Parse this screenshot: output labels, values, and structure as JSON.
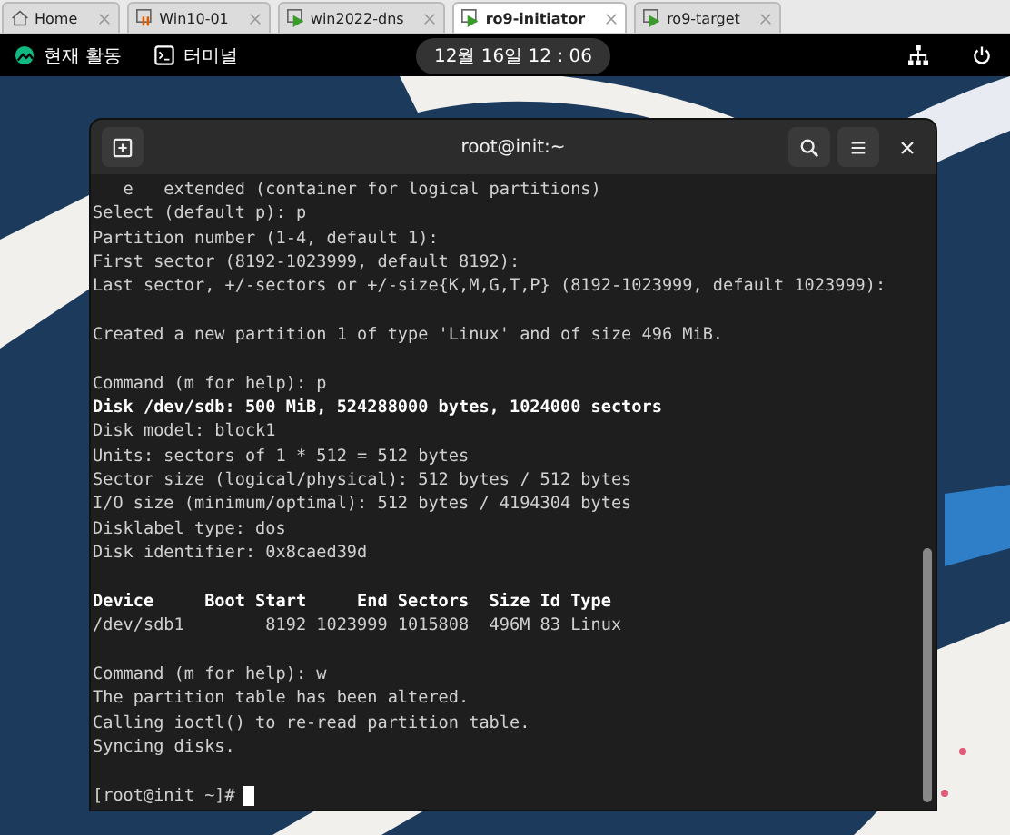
{
  "tabs": [
    {
      "label": "Home",
      "kind": "home",
      "selected": false
    },
    {
      "label": "Win10-01",
      "kind": "suspended",
      "selected": false
    },
    {
      "label": "win2022-dns",
      "kind": "running",
      "selected": false
    },
    {
      "label": "ro9-initiator",
      "kind": "running",
      "selected": true
    },
    {
      "label": "ro9-target",
      "kind": "running",
      "selected": false
    }
  ],
  "top_bar": {
    "activities": "현재 활동",
    "app": "터미널",
    "clock": "12월 16일 12 : 06"
  },
  "terminal": {
    "title": "root@init:~",
    "lines": [
      {
        "kind": "normal",
        "text": "   e   extended (container for logical partitions)"
      },
      {
        "kind": "normal",
        "text": "Select (default p): p"
      },
      {
        "kind": "normal",
        "text": "Partition number (1-4, default 1):"
      },
      {
        "kind": "normal",
        "text": "First sector (8192-1023999, default 8192):"
      },
      {
        "kind": "normal",
        "text": "Last sector, +/-sectors or +/-size{K,M,G,T,P} (8192-1023999, default 1023999):"
      },
      {
        "kind": "blank"
      },
      {
        "kind": "normal",
        "text": "Created a new partition 1 of type 'Linux' and of size 496 MiB."
      },
      {
        "kind": "blank"
      },
      {
        "kind": "normal",
        "text": "Command (m for help): p"
      },
      {
        "kind": "bold",
        "text": "Disk /dev/sdb: 500 MiB, 524288000 bytes, 1024000 sectors"
      },
      {
        "kind": "normal",
        "text": "Disk model: block1"
      },
      {
        "kind": "normal",
        "text": "Units: sectors of 1 * 512 = 512 bytes"
      },
      {
        "kind": "normal",
        "text": "Sector size (logical/physical): 512 bytes / 512 bytes"
      },
      {
        "kind": "normal",
        "text": "I/O size (minimum/optimal): 512 bytes / 4194304 bytes"
      },
      {
        "kind": "normal",
        "text": "Disklabel type: dos"
      },
      {
        "kind": "normal",
        "text": "Disk identifier: 0x8caed39d"
      },
      {
        "kind": "blank"
      },
      {
        "kind": "bold",
        "text": "Device     Boot Start     End Sectors  Size Id Type"
      },
      {
        "kind": "normal",
        "text": "/dev/sdb1        8192 1023999 1015808  496M 83 Linux"
      },
      {
        "kind": "blank"
      },
      {
        "kind": "normal",
        "text": "Command (m for help): w"
      },
      {
        "kind": "normal",
        "text": "The partition table has been altered."
      },
      {
        "kind": "normal",
        "text": "Calling ioctl() to re-read partition table."
      },
      {
        "kind": "normal",
        "text": "Syncing disks."
      },
      {
        "kind": "blank"
      },
      {
        "kind": "prompt",
        "text": "[root@init ~]#"
      }
    ]
  }
}
